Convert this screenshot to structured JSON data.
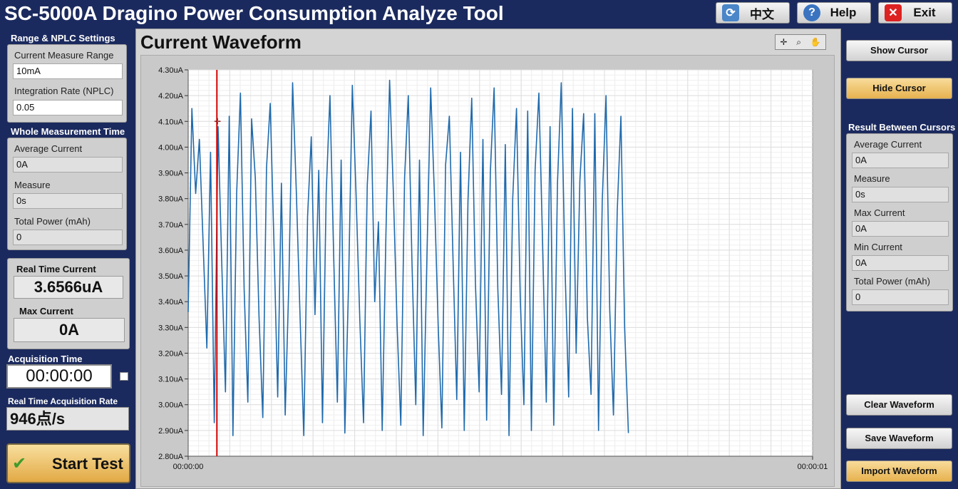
{
  "header": {
    "title": "SC-5000A Dragino Power Consumption Analyze Tool",
    "buttons": {
      "lang": "中文",
      "help": "Help",
      "exit": "Exit"
    }
  },
  "left": {
    "range_section": {
      "title": "Range & NPLC Settings",
      "current_range_label": "Current Measure Range",
      "current_range_value": "10mA",
      "nplc_label": "Integration Rate (NPLC)",
      "nplc_value": "0.05"
    },
    "whole_section": {
      "title": "Whole Measurement Time",
      "avg_label": "Average Current",
      "avg_value": "0A",
      "measure_label": "Measure",
      "measure_value": "0s",
      "power_label": "Total Power (mAh)",
      "power_value": "0"
    },
    "realtime": {
      "rt_label": "Real Time Current",
      "rt_value": "3.6566uA",
      "max_label": "Max Current",
      "max_value": "0A"
    },
    "acq": {
      "time_label": "Acquisition Time",
      "time_value": "00:00:00",
      "rate_label": "Real Time Acquisition Rate",
      "rate_value": "946点/s"
    },
    "start_button": "Start Test"
  },
  "chart": {
    "title": "Current Waveform",
    "y_ticks": [
      "4.30uA",
      "4.20uA",
      "4.10uA",
      "4.00uA",
      "3.90uA",
      "3.80uA",
      "3.70uA",
      "3.60uA",
      "3.50uA",
      "3.40uA",
      "3.30uA",
      "3.20uA",
      "3.10uA",
      "3.00uA",
      "2.90uA",
      "2.80uA"
    ],
    "x_ticks": [
      "00:00:00",
      "00:00:01"
    ]
  },
  "chart_data": {
    "type": "line",
    "title": "Current Waveform",
    "xlabel": "",
    "ylabel": "",
    "ylim": [
      2.8,
      4.3
    ],
    "x_range_fraction": [
      0,
      1
    ],
    "data_extent_fraction": 0.705,
    "cursor_x_fraction": 0.046,
    "series": [
      {
        "color": "#1f6aad",
        "values": [
          3.36,
          4.15,
          3.82,
          4.03,
          3.63,
          3.22,
          3.98,
          2.93,
          4.08,
          3.55,
          3.05,
          4.12,
          2.88,
          3.82,
          4.21,
          3.45,
          3.01,
          4.11,
          3.88,
          3.34,
          2.95,
          3.92,
          4.17,
          3.62,
          3.03,
          3.86,
          2.96,
          3.48,
          4.25,
          3.82,
          3.34,
          2.88,
          3.73,
          4.04,
          3.35,
          3.91,
          2.93,
          3.82,
          4.2,
          3.58,
          3.01,
          3.95,
          2.89,
          3.48,
          4.24,
          3.82,
          3.33,
          2.93,
          3.85,
          4.14,
          3.4,
          3.71,
          2.9,
          3.66,
          4.26,
          3.82,
          3.31,
          2.92,
          3.88,
          4.2,
          3.55,
          3.0,
          3.95,
          2.88,
          3.58,
          4.23,
          3.82,
          3.31,
          2.91,
          3.93,
          4.12,
          3.56,
          3.02,
          3.98,
          2.9,
          3.79,
          4.19,
          3.47,
          3.05,
          4.03,
          2.94,
          3.9,
          4.23,
          3.45,
          3.04,
          4.01,
          2.88,
          3.8,
          4.15,
          3.42,
          3.0,
          4.14,
          2.9,
          3.91,
          4.21,
          3.63,
          3.01,
          4.08,
          2.92,
          3.86,
          4.25,
          3.54,
          3.03,
          4.15,
          3.2,
          3.87,
          4.13,
          3.34,
          3.04,
          4.13,
          2.9,
          3.79,
          4.2,
          3.37,
          2.96,
          3.75,
          4.12,
          3.3,
          2.89
        ]
      }
    ],
    "grid": true,
    "legend": "none"
  },
  "right": {
    "show_cursor": "Show Cursor",
    "hide_cursor": "Hide Cursor",
    "result_title": "Result Between Cursors",
    "avg_label": "Average Current",
    "avg_value": "0A",
    "measure_label": "Measure",
    "measure_value": "0s",
    "max_label": "Max Current",
    "max_value": "0A",
    "min_label": "Min Current",
    "min_value": "0A",
    "power_label": "Total Power (mAh)",
    "power_value": "0",
    "clear": "Clear Waveform",
    "save": "Save Waveform",
    "import": "Import Waveform"
  },
  "colors": {
    "background": "#1b2a5e",
    "trace": "#1f6aad",
    "cursor": "#d40000",
    "gold_button": "#e7b24f"
  }
}
